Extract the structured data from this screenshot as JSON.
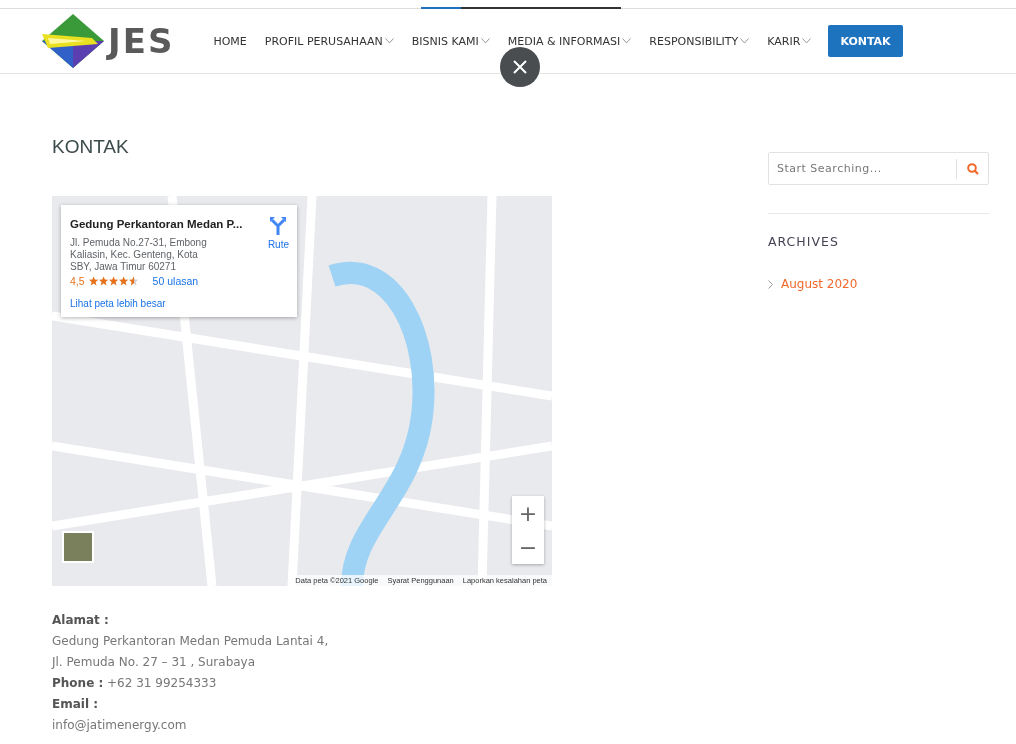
{
  "header": {
    "logo": "JES",
    "nav": [
      {
        "label": "HOME",
        "has_menu": false,
        "selected": false
      },
      {
        "label": "PROFIL PERUSAHAAN",
        "has_menu": true,
        "selected": false
      },
      {
        "label": "BISNIS KAMI",
        "has_menu": true,
        "selected": false
      },
      {
        "label": "MEDIA & INFORMASI",
        "has_menu": true,
        "selected": false
      },
      {
        "label": "RESPONSIBILITY",
        "has_menu": true,
        "selected": false
      },
      {
        "label": "KARIR",
        "has_menu": true,
        "selected": false
      },
      {
        "label": "KONTAK",
        "has_menu": false,
        "selected": true
      }
    ]
  },
  "page_title": "KONTAK",
  "map": {
    "place_card": {
      "name": "Gedung Perkantoran Medan P...",
      "address": "Jl. Pemuda No.27-31, Embong Kaliasin, Kec. Genteng, Kota SBY, Jawa Timur 60271",
      "rating": "4,5",
      "stars": 4.5,
      "reviews": "50 ulasan",
      "directions": "Rute",
      "larger_map": "Lihat peta lebih besar"
    },
    "zoom_in": "+",
    "zoom_out": "−",
    "attribution": [
      "Data peta ©2021 Google",
      "Syarat Penggunaan",
      "Laporkan kesalahan peta"
    ]
  },
  "contact": [
    {
      "kind": "label",
      "text": "Alamat :"
    },
    {
      "kind": "value",
      "text": "Gedung Perkantoran Medan Pemuda Lantai 4,"
    },
    {
      "kind": "value",
      "text": "Jl. Pemuda No. 27 – 31 , Surabaya"
    },
    {
      "kind": "value",
      "text": "**Phone :** +62 31 99254333"
    },
    {
      "kind": "label",
      "text": "Email :"
    },
    {
      "kind": "value",
      "text": "info@jatimenergy.com"
    }
  ],
  "sidebar": {
    "search": {
      "placeholder": "Start Searching..."
    },
    "archives_title": "ARCHIVES",
    "archives": [
      {
        "label": "August 2020"
      }
    ]
  }
}
